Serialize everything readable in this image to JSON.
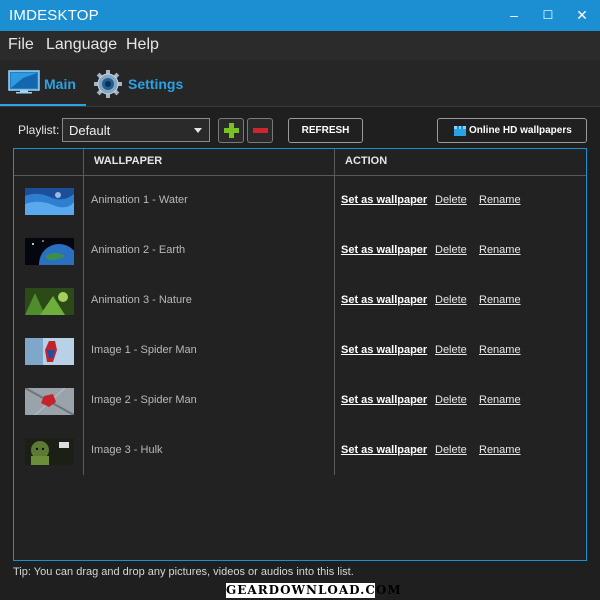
{
  "window": {
    "title": "IMDESKTOP",
    "minimize_glyph": "–",
    "maximize_glyph": "☐",
    "close_glyph": "✕"
  },
  "menu": [
    "File",
    "Language",
    "Help"
  ],
  "tabs": [
    {
      "label": "Main",
      "icon": "monitor-icon",
      "active": true
    },
    {
      "label": "Settings",
      "icon": "gear-icon",
      "active": false
    }
  ],
  "toolbar": {
    "playlist_label": "Playlist:",
    "playlist_value": "Default",
    "add_icon": "plus-icon",
    "remove_icon": "minus-icon",
    "refresh_label": "REFRESH",
    "online_label": "Online HD wallpapers"
  },
  "table": {
    "headers": [
      "WALLPAPER",
      "ACTION"
    ],
    "action_labels": [
      "Set as wallpaper",
      "Delete",
      "Rename"
    ],
    "rows": [
      {
        "name": "Animation 1 - Water",
        "thumb": "water"
      },
      {
        "name": "Animation 2 - Earth",
        "thumb": "earth"
      },
      {
        "name": "Animation 3 - Nature",
        "thumb": "nature"
      },
      {
        "name": "Image 1 - Spider Man",
        "thumb": "spider1"
      },
      {
        "name": "Image 2 - Spider Man",
        "thumb": "spider2"
      },
      {
        "name": "Image 3 - Hulk",
        "thumb": "hulk"
      }
    ]
  },
  "tip": "Tip: You can drag and drop any pictures, videos or audios into this list.",
  "watermark": "GearDownload.com",
  "colors": {
    "accent": "#1b8fd2",
    "background": "#1f1f1f",
    "add_green": "#7ac21e",
    "remove_red": "#d0252b"
  }
}
